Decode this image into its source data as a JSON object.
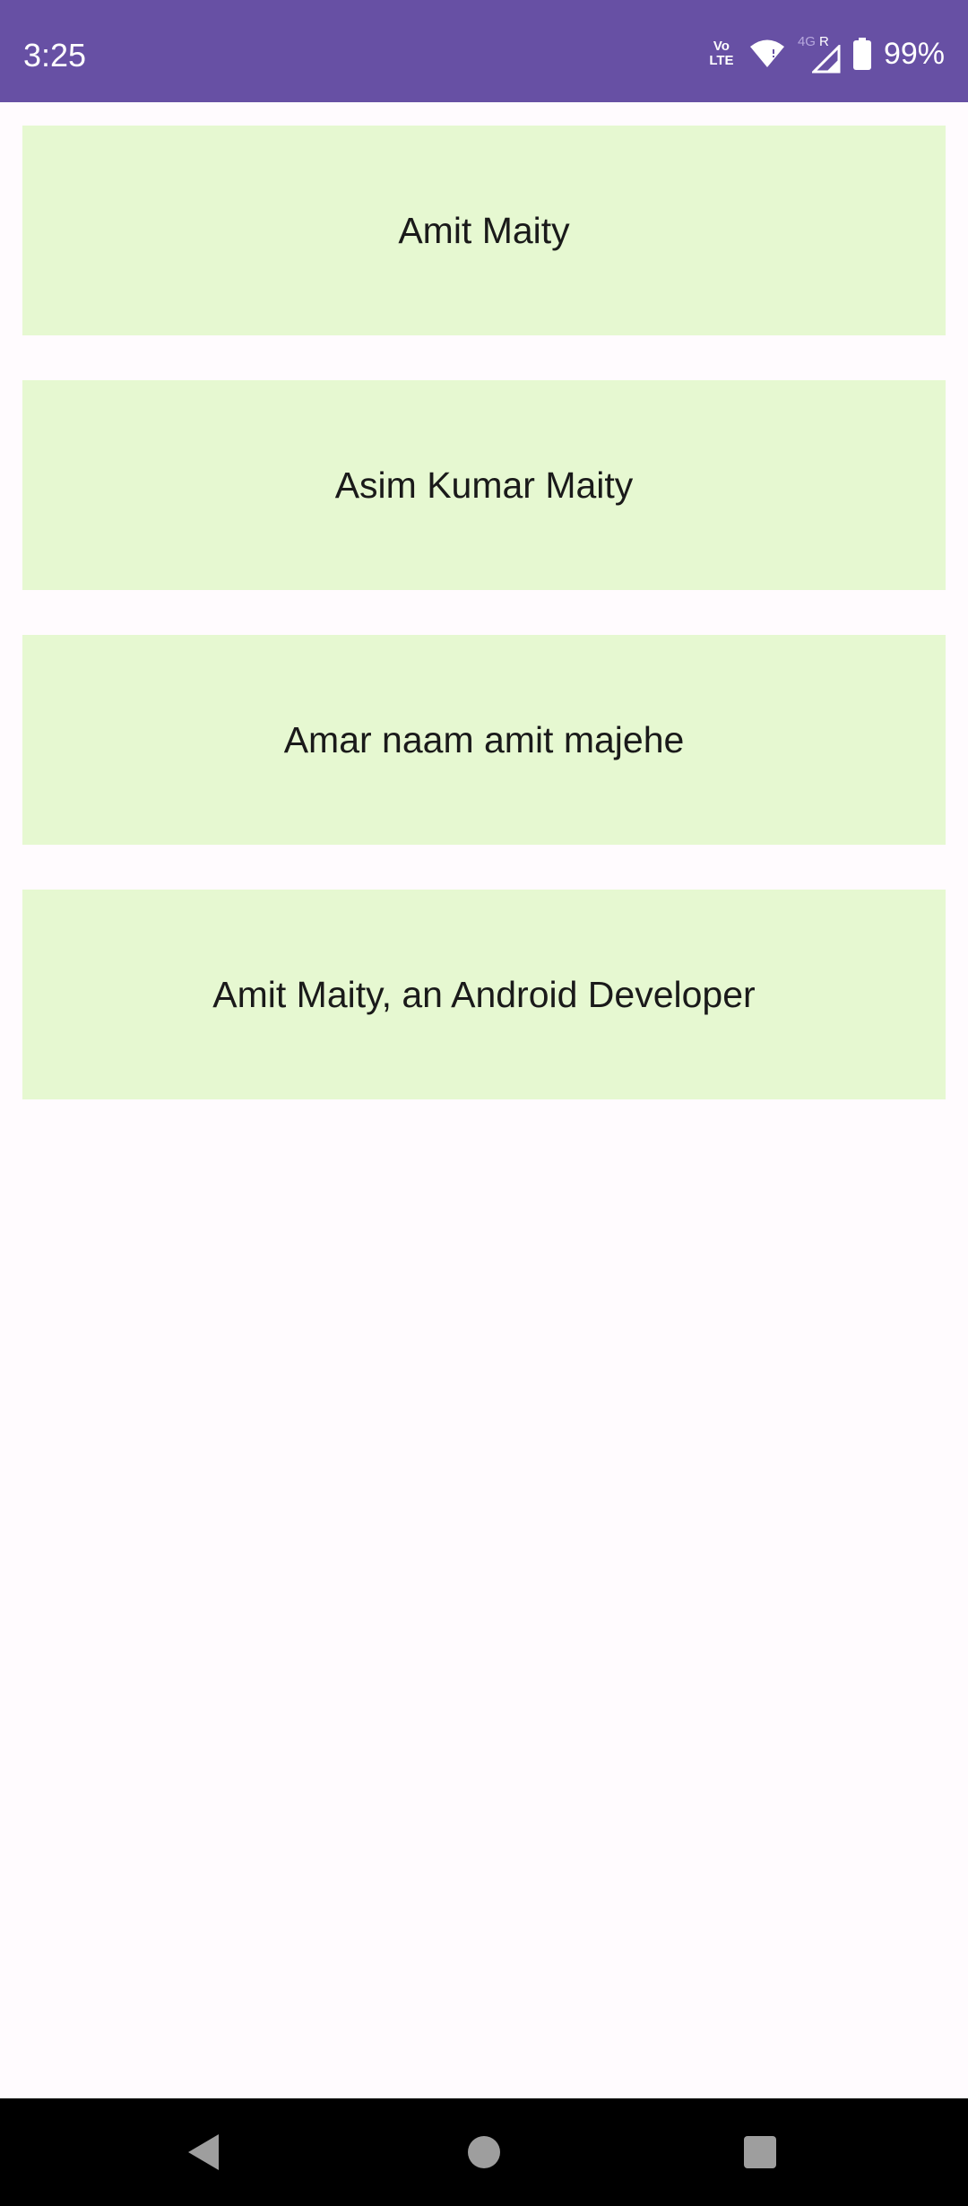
{
  "status_bar": {
    "time": "3:25",
    "volte_line1": "Vo",
    "volte_line2": "LTE",
    "network_type": "4G",
    "roaming": "R",
    "battery": "99%",
    "background": "#6750a4"
  },
  "list": {
    "items": [
      {
        "label": "Amit Maity"
      },
      {
        "label": "Asim Kumar Maity"
      },
      {
        "label": "Amar naam amit majehe"
      },
      {
        "label": "Amit Maity, an Android Developer"
      }
    ],
    "card_color": "#e6f8d1"
  },
  "nav_bar": {
    "back_icon": "back-triangle",
    "home_icon": "home-circle",
    "recents_icon": "recents-square"
  }
}
